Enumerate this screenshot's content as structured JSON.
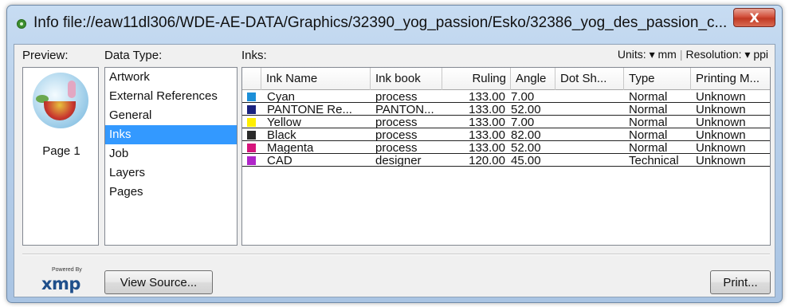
{
  "window": {
    "title": "Info file://eaw11dl306/WDE-AE-DATA/Graphics/32390_yog_passion/Esko/32386_yog_des_passion_c...",
    "close_glyph": "X"
  },
  "labels": {
    "preview": "Preview:",
    "data_type": "Data Type:",
    "inks": "Inks:"
  },
  "units_bar": {
    "units_label": "Units:",
    "units_value": "mm",
    "resolution_label": "Resolution:",
    "resolution_value": "ppi",
    "dropdown_glyph": "▾",
    "separator": "|"
  },
  "preview": {
    "page_label": "Page 1"
  },
  "data_types": [
    "Artwork",
    "External References",
    "General",
    "Inks",
    "Job",
    "Layers",
    "Pages"
  ],
  "selected_data_type": "Inks",
  "table": {
    "headers": [
      "Ink Name",
      "Ink book",
      "Ruling",
      "Angle",
      "Dot Sh...",
      "Type",
      "Printing M..."
    ],
    "rows": [
      {
        "color": "#1c8fd8",
        "name": "Cyan",
        "book": "process",
        "ruling": "133.00",
        "angle": "7.00",
        "dot": "",
        "type": "Normal",
        "printing": "Unknown"
      },
      {
        "color": "#1a237e",
        "name": "PANTONE Re...",
        "book": "PANTON...",
        "ruling": "133.00",
        "angle": "52.00",
        "dot": "",
        "type": "Normal",
        "printing": "Unknown"
      },
      {
        "color": "#ffee00",
        "name": "Yellow",
        "book": "process",
        "ruling": "133.00",
        "angle": "7.00",
        "dot": "",
        "type": "Normal",
        "printing": "Unknown"
      },
      {
        "color": "#2b2b2b",
        "name": "Black",
        "book": "process",
        "ruling": "133.00",
        "angle": "82.00",
        "dot": "",
        "type": "Normal",
        "printing": "Unknown"
      },
      {
        "color": "#d6157c",
        "name": "Magenta",
        "book": "process",
        "ruling": "133.00",
        "angle": "52.00",
        "dot": "",
        "type": "Normal",
        "printing": "Unknown"
      },
      {
        "color": "#b026c9",
        "name": "CAD",
        "book": "designer",
        "ruling": "120.00",
        "angle": "45.00",
        "dot": "",
        "type": "Technical",
        "printing": "Unknown"
      }
    ]
  },
  "footer": {
    "logo_powered": "Powered By",
    "logo_word": "xmp",
    "view_source": "View Source...",
    "print": "Print..."
  },
  "colors": {
    "selection": "#3399ff",
    "title_gradient_top": "#c7dcf2",
    "close_button": "#c13a24"
  }
}
